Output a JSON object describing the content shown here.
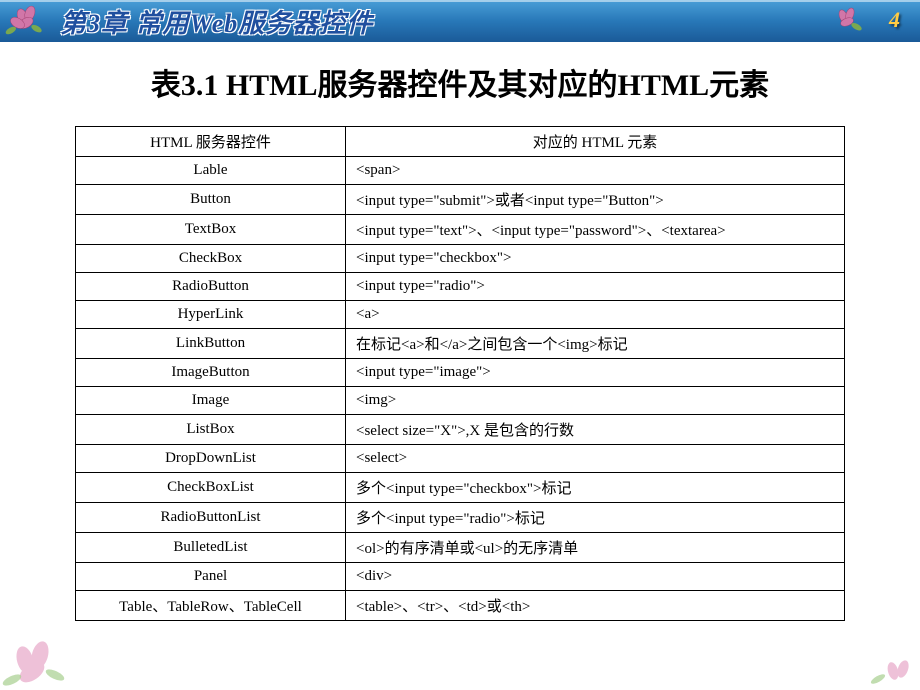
{
  "header": {
    "chapter_title": "第3章 常用Web服务器控件",
    "page_number": "4"
  },
  "title": "表3.1  HTML服务器控件及其对应的HTML元素",
  "table": {
    "headers": {
      "control": "HTML 服务器控件",
      "element": "对应的 HTML 元素"
    },
    "rows": [
      {
        "control": "Lable",
        "element": "<span>"
      },
      {
        "control": "Button",
        "element": "<input type=\"submit\">或者<input type=\"Button\">"
      },
      {
        "control": "TextBox",
        "element": "<input type=\"text\">、<input type=\"password\">、<textarea>"
      },
      {
        "control": "CheckBox",
        "element": "<input type=\"checkbox\">"
      },
      {
        "control": "RadioButton",
        "element": "<input type=\"radio\">"
      },
      {
        "control": "HyperLink",
        "element": "<a>"
      },
      {
        "control": "LinkButton",
        "element": "在标记<a>和</a>之间包含一个<img>标记"
      },
      {
        "control": "ImageButton",
        "element": "<input type=\"image\">"
      },
      {
        "control": "Image",
        "element": "<img>"
      },
      {
        "control": "ListBox",
        "element": "<select size=\"X\">,X 是包含的行数"
      },
      {
        "control": "DropDownList",
        "element": "<select>"
      },
      {
        "control": "CheckBoxList",
        "element": "多个<input type=\"checkbox\">标记"
      },
      {
        "control": "RadioButtonList",
        "element": "多个<input type=\"radio\">标记"
      },
      {
        "control": "BulletedList",
        "element": "<ol>的有序清单或<ul>的无序清单"
      },
      {
        "control": "Panel",
        "element": "<div>"
      },
      {
        "control": "Table、TableRow、TableCell",
        "element": "<table>、<tr>、<td>或<th>"
      }
    ]
  }
}
